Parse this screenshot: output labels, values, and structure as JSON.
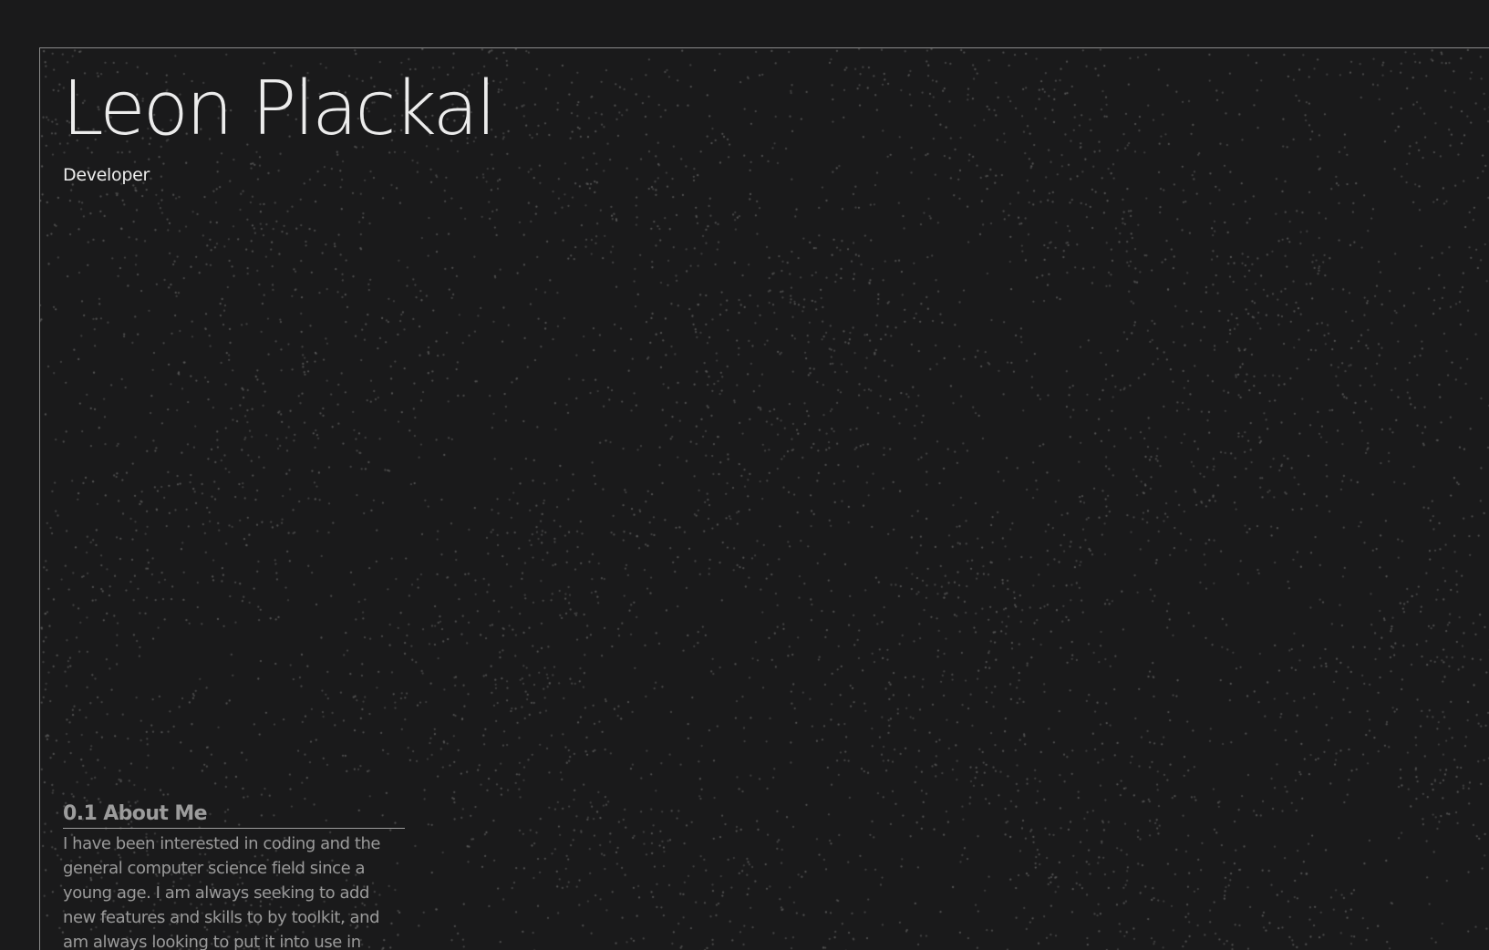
{
  "hero": {
    "name": "Leon Plackal",
    "role": "Developer"
  },
  "about": {
    "heading": "0.1 About Me",
    "text": "I have been interested in coding and the general computer science field since a young age. I am always seeking to add new features and skills to by toolkit, and am always looking to put it into use in"
  },
  "colors": {
    "background": "#1a1a1b",
    "text_primary": "#ececec",
    "text_muted": "#9a9a9a",
    "frame_border": "#8a8a8a",
    "dots": "#5c5c5c"
  }
}
